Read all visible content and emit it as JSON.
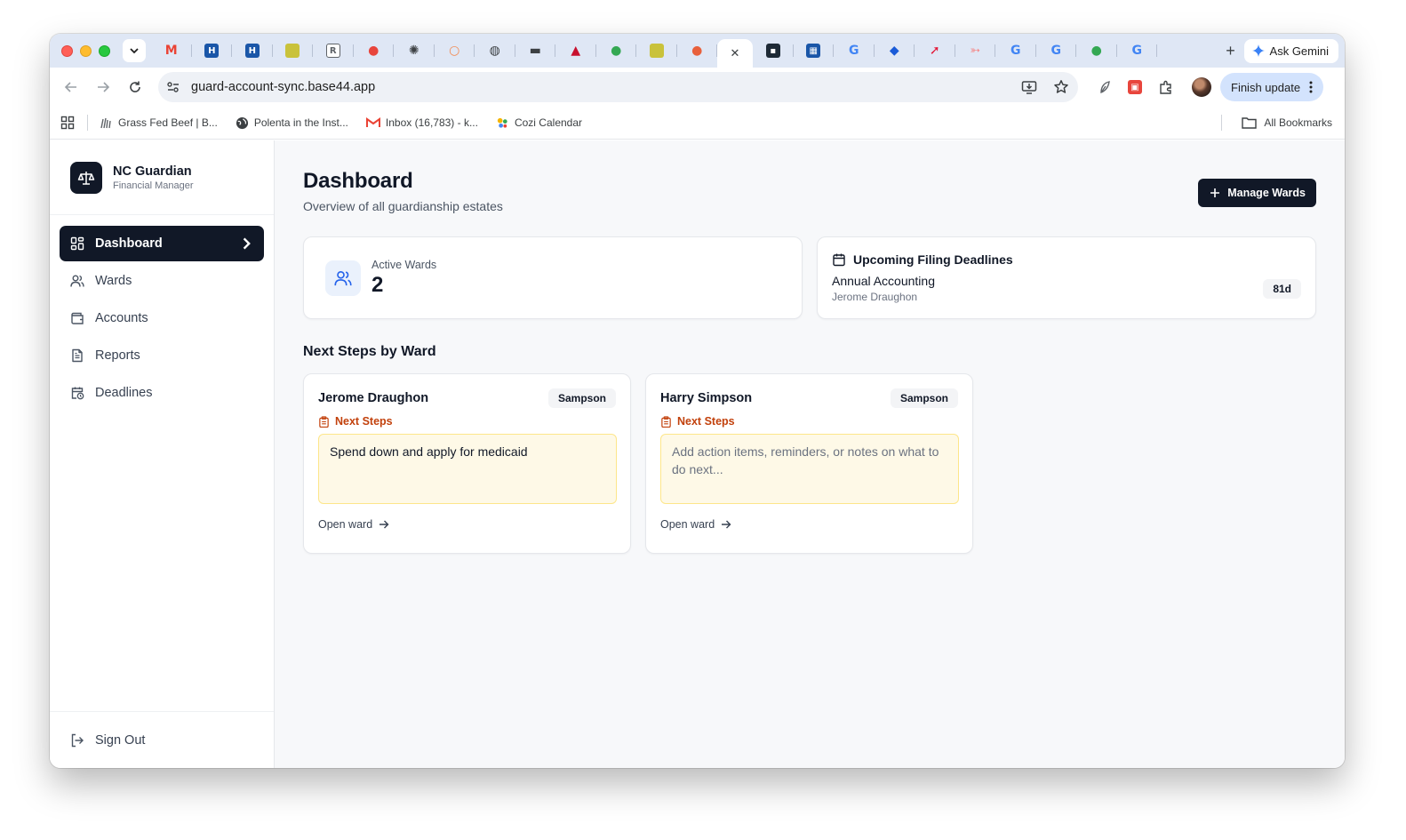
{
  "browser": {
    "gemini_label": "Ask Gemini",
    "url": "guard-account-sync.base44.app",
    "finish_update_label": "Finish update",
    "bookmarks": [
      {
        "label": "Grass Fed Beef | B...",
        "icon": "grass-icon"
      },
      {
        "label": "Polenta in the Inst...",
        "icon": "globe-icon"
      },
      {
        "label": "Inbox (16,783) - k...",
        "icon": "gmail-icon"
      },
      {
        "label": "Cozi Calendar",
        "icon": "cozi-icon"
      }
    ],
    "all_bookmarks_label": "All Bookmarks",
    "tab_favicons": [
      {
        "icon": "gmail-icon",
        "color": "#ea4335",
        "glyph": "M"
      },
      {
        "icon": "h-icon",
        "color": "#1a56a8",
        "glyph": "H"
      },
      {
        "icon": "h-icon",
        "color": "#1a56a8",
        "glyph": "H"
      },
      {
        "icon": "note-icon",
        "color": "#c9c23b",
        "glyph": ""
      },
      {
        "icon": "r-icon",
        "color": "#5f6368",
        "glyph": "R"
      },
      {
        "icon": "map-pin-icon",
        "color": "#e8453c",
        "glyph": "●"
      },
      {
        "icon": "openai-icon",
        "color": "#3c4043",
        "glyph": "✺"
      },
      {
        "icon": "ring-icon",
        "color": "#f28b53",
        "glyph": "○"
      },
      {
        "icon": "globe-icon",
        "color": "#3c4043",
        "glyph": "◍"
      },
      {
        "icon": "tool-icon",
        "color": "#3c4043",
        "glyph": "▬"
      },
      {
        "icon": "delta-icon",
        "color": "#c8102e",
        "glyph": "▲"
      },
      {
        "icon": "maps-icon",
        "color": "#34a853",
        "glyph": "●"
      },
      {
        "icon": "note-icon",
        "color": "#c9c23b",
        "glyph": ""
      },
      {
        "icon": "sun-icon",
        "color": "#e8603c",
        "glyph": "●"
      },
      {
        "icon": "close-icon",
        "color": "#3c4043",
        "glyph": "✕"
      },
      {
        "icon": "terminal-icon",
        "color": "#1e2a36",
        "glyph": "▪"
      },
      {
        "icon": "grid-app-icon",
        "color": "#1a56a8",
        "glyph": "▦"
      },
      {
        "icon": "google-icon",
        "color": "#4285f4",
        "glyph": "G"
      },
      {
        "icon": "chase-icon",
        "color": "#1a5bd8",
        "glyph": "◆"
      },
      {
        "icon": "swoosh-icon",
        "color": "#e31837",
        "glyph": "➚"
      },
      {
        "icon": "fish-icon",
        "color": "#f48a8a",
        "glyph": "➳"
      },
      {
        "icon": "google-icon",
        "color": "#4285f4",
        "glyph": "G"
      },
      {
        "icon": "google-icon",
        "color": "#4285f4",
        "glyph": "G"
      },
      {
        "icon": "maps-icon",
        "color": "#34a853",
        "glyph": "●"
      },
      {
        "icon": "google-icon",
        "color": "#4285f4",
        "glyph": "G"
      }
    ]
  },
  "app": {
    "brand_name": "NC Guardian",
    "brand_sub": "Financial Manager",
    "nav": [
      {
        "label": "Dashboard",
        "icon": "dashboard-icon",
        "active": true
      },
      {
        "label": "Wards",
        "icon": "users-icon",
        "active": false
      },
      {
        "label": "Accounts",
        "icon": "wallet-icon",
        "active": false
      },
      {
        "label": "Reports",
        "icon": "file-text-icon",
        "active": false
      },
      {
        "label": "Deadlines",
        "icon": "calendar-clock-icon",
        "active": false
      }
    ],
    "sign_out_label": "Sign Out"
  },
  "dashboard": {
    "title": "Dashboard",
    "subtitle": "Overview of all guardianship estates",
    "manage_wards_label": "Manage Wards",
    "active_wards_label": "Active Wards",
    "active_wards_value": "2",
    "deadlines": {
      "heading": "Upcoming Filing Deadlines",
      "item_title": "Annual Accounting",
      "item_ward": "Jerome Draughon",
      "item_days": "81d"
    },
    "next_steps_heading": "Next Steps by Ward",
    "wards": [
      {
        "name": "Jerome Draughon",
        "badge": "Sampson",
        "next_steps_label": "Next Steps",
        "note_value": "Spend down and apply for medicaid",
        "note_placeholder": "",
        "open_label": "Open ward"
      },
      {
        "name": "Harry Simpson",
        "badge": "Sampson",
        "next_steps_label": "Next Steps",
        "note_value": "",
        "note_placeholder": "Add action items, reminders, or notes on what to do next...",
        "open_label": "Open ward"
      }
    ]
  },
  "colors": {
    "primary": "#111827",
    "accent_orange": "#c2410c",
    "note_bg": "#fef9e7",
    "icon_blue": "#2563eb"
  }
}
